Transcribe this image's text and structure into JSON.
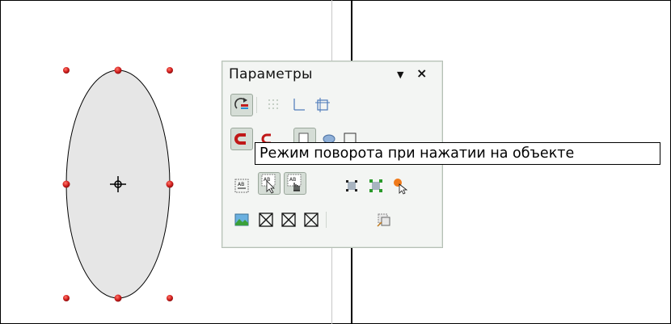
{
  "panel": {
    "title": "Параметры",
    "menu_icon": "dropdown-arrow-icon",
    "close_label": "×",
    "rows": [
      [
        "rotation-mode-icon",
        "show-grid-icon",
        "helplines-while-moving-icon",
        "snap-to-page-margins-icon"
      ],
      [
        "snap-to-object-border-icon",
        "snap-to-object-points-icon",
        "allow-quick-editing-icon",
        "select-text-area-only-icon",
        "double-click-text-edit-icon"
      ],
      [
        "text-frame-icon",
        "select-text-area-only-icon",
        "edit-text-on-click-icon",
        "simple-handles-icon",
        "large-handles-icon",
        "exit-all-groups-icon"
      ],
      [
        "image-placeholder-icon",
        "contour-mode-icon",
        "text-placeholder-icon",
        "line-contour-only-icon",
        "double-click-edit-icon"
      ]
    ]
  },
  "tooltip": {
    "text": "Режим поворота при нажатии на объекте"
  },
  "colors": {
    "handle": "#d42020",
    "ellipse_fill": "#e6e6e6",
    "panel_bg": "#f3f5f3"
  }
}
